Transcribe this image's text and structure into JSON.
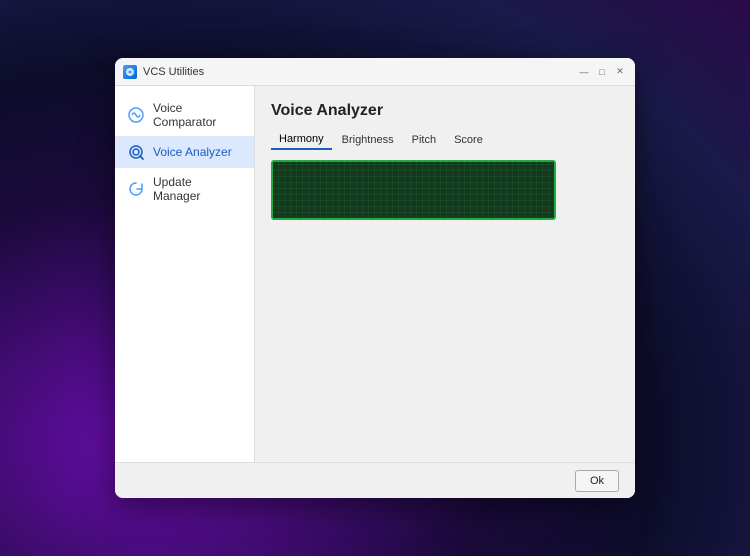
{
  "window": {
    "title": "VCS Utilities",
    "minimize_label": "—",
    "maximize_label": "□",
    "close_label": "✕"
  },
  "sidebar": {
    "items": [
      {
        "id": "voice-comparator",
        "label": "Voice Comparator",
        "active": false
      },
      {
        "id": "voice-analyzer",
        "label": "Voice Analyzer",
        "active": true
      },
      {
        "id": "update-manager",
        "label": "Update Manager",
        "active": false
      }
    ]
  },
  "main": {
    "page_title": "Voice Analyzer",
    "tabs": [
      {
        "id": "harmony",
        "label": "Harmony",
        "active": true
      },
      {
        "id": "brightness",
        "label": "Brightness",
        "active": false
      },
      {
        "id": "pitch",
        "label": "Pitch",
        "active": false
      },
      {
        "id": "score",
        "label": "Score",
        "active": false
      }
    ]
  },
  "footer": {
    "ok_label": "Ok"
  }
}
